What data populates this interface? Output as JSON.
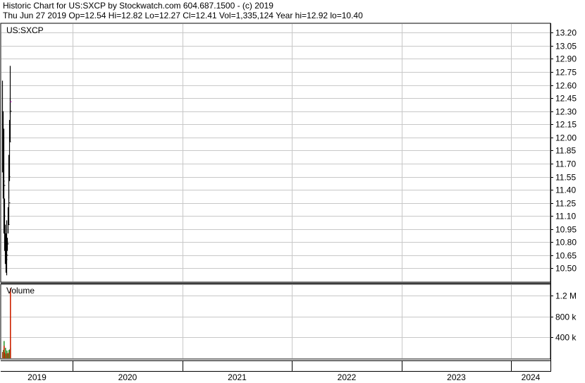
{
  "header": {
    "line1": "Historic Chart for US:SXCP by Stockwatch.com 604.687.1500 - (c) 2019",
    "line2": "Thu Jun 27 2019  Op=12.54  Hi=12.82  Lo=12.27  Cl=12.41  Vol=1,335,124  Year hi=12.92  lo=10.40"
  },
  "chart_data": [
    {
      "type": "candlestick",
      "title": "US:SXCP",
      "x_years": [
        "2019",
        "2020",
        "2021",
        "2022",
        "2023",
        "2024"
      ],
      "y_ticks": [
        "13.20",
        "13.05",
        "12.90",
        "12.75",
        "12.60",
        "12.45",
        "12.30",
        "12.15",
        "12.00",
        "11.85",
        "11.70",
        "11.55",
        "11.40",
        "11.25",
        "11.10",
        "10.95",
        "10.80",
        "10.65",
        "10.50"
      ],
      "ylim": [
        10.35,
        13.3
      ],
      "x": [
        "2019-01-02",
        "2019-01-15",
        "2019-01-28",
        "2019-02-08",
        "2019-02-21",
        "2019-03-06",
        "2019-03-18",
        "2019-03-29",
        "2019-04-10",
        "2019-04-23",
        "2019-05-06",
        "2019-05-17",
        "2019-05-30",
        "2019-06-11",
        "2019-06-20",
        "2019-06-27"
      ],
      "high": [
        12.65,
        12.3,
        12.1,
        11.5,
        11.3,
        11.0,
        10.9,
        10.75,
        11.05,
        10.85,
        11.2,
        11.4,
        11.8,
        12.2,
        12.45,
        12.82
      ],
      "low": [
        11.6,
        11.3,
        11.2,
        10.9,
        10.7,
        10.55,
        10.45,
        10.42,
        10.6,
        10.7,
        10.9,
        11.0,
        11.3,
        11.5,
        11.95,
        12.27
      ],
      "close": [
        11.9,
        11.5,
        11.45,
        11.1,
        10.85,
        10.7,
        10.6,
        10.65,
        10.8,
        10.78,
        11.0,
        11.25,
        11.55,
        11.95,
        12.3,
        12.41
      ]
    },
    {
      "type": "bar",
      "title": "Volume",
      "y_ticks": [
        "1.2 M",
        "800 k",
        "400 k"
      ],
      "ylim": [
        0,
        1400000
      ],
      "x": [
        "2019-01-02",
        "2019-01-15",
        "2019-01-28",
        "2019-02-08",
        "2019-02-21",
        "2019-03-06",
        "2019-03-18",
        "2019-03-29",
        "2019-04-10",
        "2019-04-23",
        "2019-05-06",
        "2019-05-17",
        "2019-05-30",
        "2019-06-11",
        "2019-06-20",
        "2019-06-27"
      ],
      "values": [
        120000,
        160000,
        330000,
        240000,
        110000,
        200000,
        90000,
        150000,
        130000,
        100000,
        90000,
        160000,
        110000,
        170000,
        200000,
        1335124
      ],
      "direction": [
        "down",
        "up",
        "up",
        "down",
        "down",
        "up",
        "down",
        "up",
        "up",
        "down",
        "up",
        "up",
        "down",
        "up",
        "up",
        "down"
      ]
    }
  ],
  "colors": {
    "grid": "#c8c8c8",
    "frame": "#000000",
    "price_bar": "#000000",
    "last_close_marker": "#cc00cc",
    "volume_up": "#339933",
    "volume_down": "#cc2200"
  }
}
